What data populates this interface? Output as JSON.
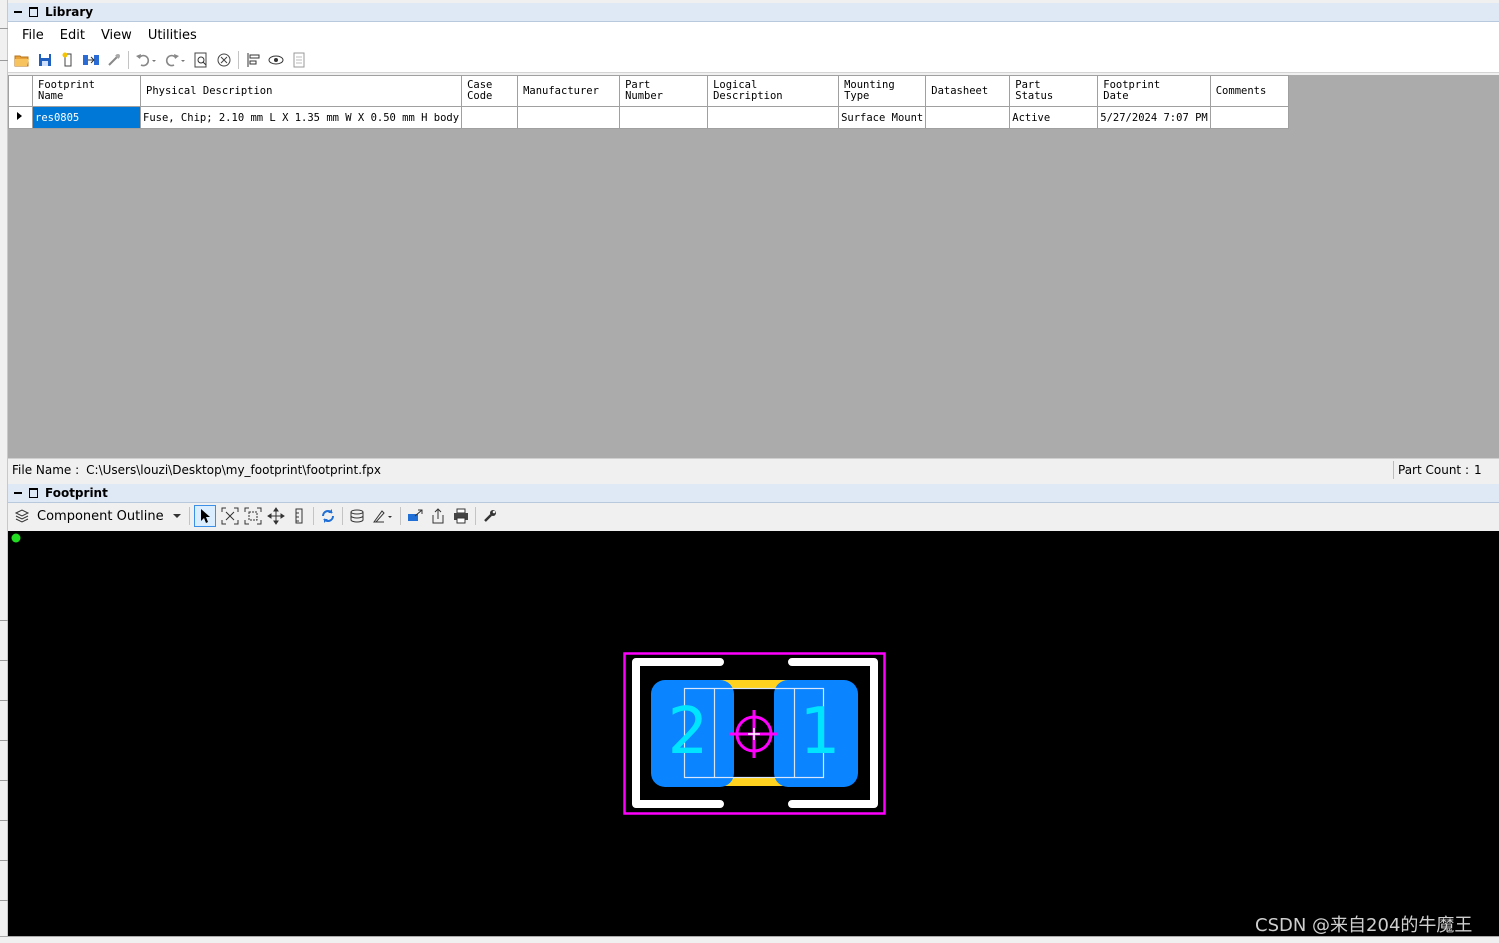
{
  "library": {
    "title": "Library",
    "menu": [
      "File",
      "Edit",
      "View",
      "Utilities"
    ],
    "toolbar_icons": [
      "open-folder-icon",
      "save-icon",
      "new-footprint-icon",
      "import-icon",
      "wizard-icon",
      "undo-icon",
      "redo-icon",
      "find-icon",
      "close-circle-icon",
      "align-icon",
      "view-icon",
      "report-icon"
    ]
  },
  "grid": {
    "columns": [
      "Footprint\nName",
      "Physical Description",
      "Case\nCode",
      "Manufacturer",
      "Part\nNumber",
      "Logical\nDescription",
      "Mounting\nType",
      "Datasheet",
      "Part\nStatus",
      "Footprint\nDate",
      "Comments"
    ],
    "rows": [
      [
        "res0805",
        "Fuse, Chip; 2.10 mm L X 1.35 mm W X 0.50 mm H body",
        "",
        "",
        "",
        "",
        "Surface Mount",
        "",
        "Active",
        "5/27/2024 7:07 PM",
        ""
      ]
    ]
  },
  "status": {
    "file_label": "File Name :",
    "file_path": "C:\\Users\\louzi\\Desktop\\my_footprint\\footprint.fpx",
    "part_count_label": "Part Count :",
    "part_count": "1"
  },
  "footprint": {
    "title": "Footprint",
    "layer_select": "Component Outline",
    "pad_left_label": "2",
    "pad_right_label": "1",
    "colors": {
      "courtyard": "#ff00ff",
      "silkscreen": "#ffffff",
      "pad": "#0a84ff",
      "pad_label": "#00e5ff",
      "body": "#ffd21f",
      "background": "#000000"
    }
  },
  "watermark": "CSDN @来自204的牛魔王"
}
